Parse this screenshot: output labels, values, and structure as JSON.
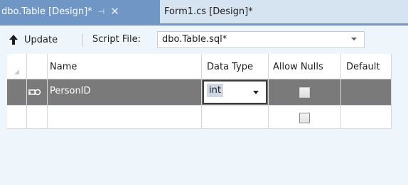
{
  "tabs": [
    {
      "label": "dbo.Table [Design]*",
      "active": true,
      "pin_glyph": "⊣",
      "close_glyph": "✕"
    },
    {
      "label": "Form1.cs [Design]*",
      "active": false
    }
  ],
  "toolbar": {
    "update_label": "Update",
    "script_file_label": "Script File:",
    "script_file_value": "dbo.Table.sql*"
  },
  "grid": {
    "columns": [
      "Name",
      "Data Type",
      "Allow Nulls",
      "Default"
    ],
    "rows": [
      {
        "name": "PersonID",
        "data_type": "int",
        "allow_nulls": false,
        "default": "",
        "primary_key": true,
        "selected": true
      },
      {
        "name": "",
        "data_type": "",
        "allow_nulls": false,
        "default": "",
        "primary_key": false,
        "selected": false
      }
    ]
  },
  "colors": {
    "active_tab": "#6f96c4",
    "tab_strip": "#d6e4f1",
    "background": "#eef5fb",
    "selected_row": "#7a7a7a",
    "grid_lines": "#d2d7de"
  },
  "icons": {
    "update": "up-arrow-icon",
    "primary_key": "key-icon",
    "pin": "pin-icon",
    "close": "close-icon"
  }
}
